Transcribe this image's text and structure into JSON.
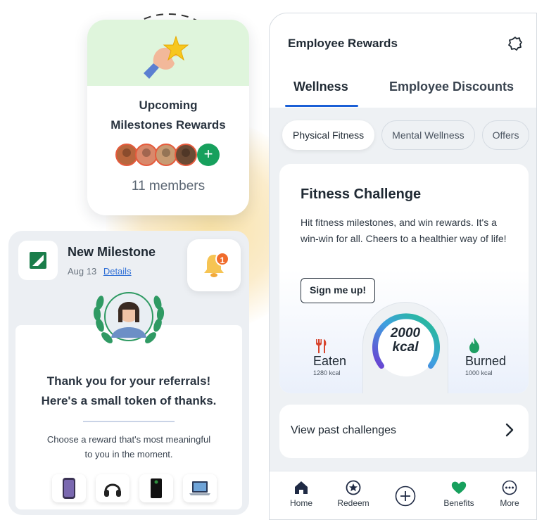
{
  "milestones_card": {
    "title_line1": "Upcoming",
    "title_line2": "Milestones Rewards",
    "members": "11 members",
    "avatar_colors": [
      "#b8663d",
      "#d9886a",
      "#c79b73",
      "#6b4a34"
    ],
    "add_icon": "plus-icon"
  },
  "milestone_card": {
    "title": "New Milestone",
    "date": "Aug 13",
    "details_link": "Details",
    "notification_count": "1",
    "thanks_line1": "Thank you for your referrals!",
    "thanks_line2": "Here's a small token of thanks.",
    "choose_line1": "Choose a reward that's most meaningful",
    "choose_line2": "to you in the moment.",
    "reward_icons": [
      "phone-icon",
      "headphones-icon",
      "console-icon",
      "laptop-icon"
    ]
  },
  "app": {
    "title": "Employee Rewards",
    "tabs": [
      {
        "label": "Wellness",
        "active": true
      },
      {
        "label": "Employee Discounts",
        "active": false
      }
    ],
    "chips": [
      {
        "label": "Physical Fitness",
        "active": true
      },
      {
        "label": "Mental Wellness",
        "active": false
      },
      {
        "label": "Offers",
        "active": false
      }
    ],
    "challenge": {
      "title": "Fitness Challenge",
      "description": "Hit fitness milestones, and win rewards. It's a win-win for all. Cheers to a healthier way of life!",
      "cta": "Sign me up!",
      "gauge_value": "2000",
      "gauge_unit": "kcal",
      "eaten_label": "Eaten",
      "eaten_value": "1280 kcal",
      "burned_label": "Burned",
      "burned_value": "1000 kcal"
    },
    "past_challenges": "View past challenges",
    "nav": [
      {
        "label": "Home",
        "icon": "home-icon"
      },
      {
        "label": "Redeem",
        "icon": "star-badge-icon"
      },
      {
        "label": "",
        "icon": "plus-circle-icon"
      },
      {
        "label": "Benefits",
        "icon": "heart-icon",
        "active": true
      },
      {
        "label": "More",
        "icon": "more-icon"
      }
    ],
    "accent_color": "#1a5fd6",
    "benefit_color": "#17a05d"
  }
}
